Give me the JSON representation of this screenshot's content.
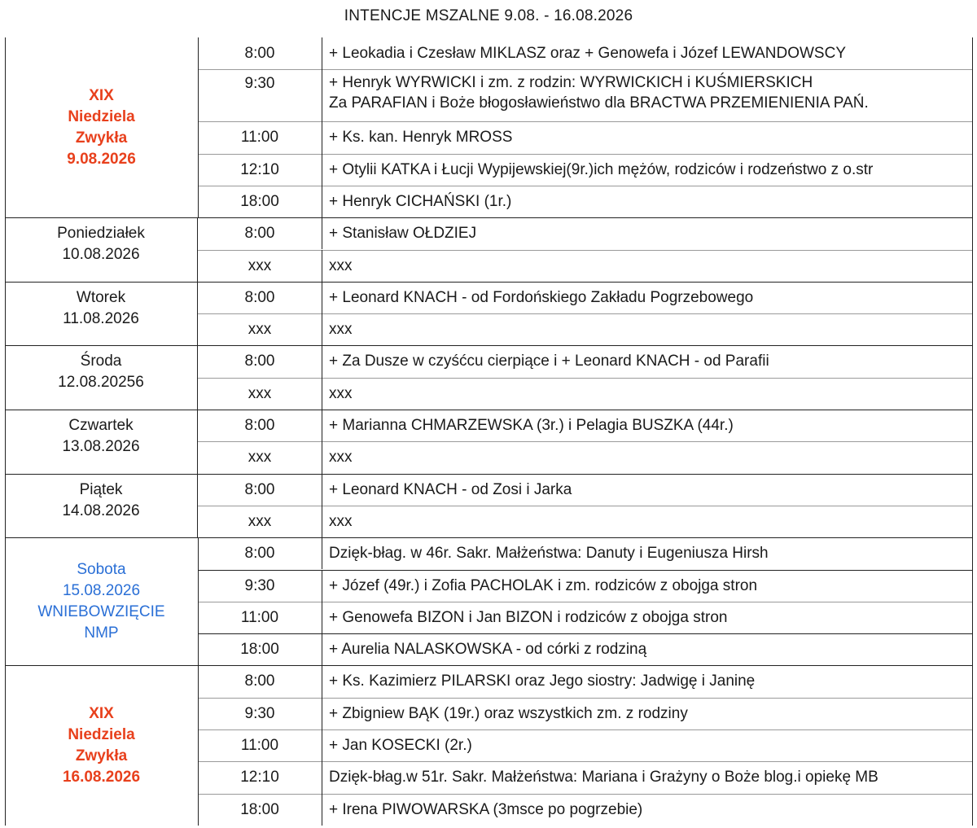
{
  "title": "INTENCJE MSZALNE 9.08. - 16.08.2026",
  "days": [
    {
      "label": [
        "XIX",
        "Niedziela",
        "Zwykła",
        "9.08.2026"
      ],
      "style": "red",
      "rows": [
        {
          "time": "8:00",
          "text": [
            "+ Leokadia i Czesław MIKLASZ oraz + Genowefa i Józef LEWANDOWSCY"
          ]
        },
        {
          "time": "9:30",
          "text": [
            "+ Henryk WYRWICKI i zm. z rodzin: WYRWICKICH i KUŚMIERSKICH",
            "Za PARAFIAN i  Boże błogosławieństwo dla BRACTWA PRZEMIENIENIA PAŃ."
          ]
        },
        {
          "time": "11:00",
          "text": [
            "+ Ks. kan. Henryk MROSS"
          ]
        },
        {
          "time": "12:10",
          "text": [
            "+ Otylii KATKA i Łucji Wypijewskiej(9r.)ich mężów, rodziców i rodzeństwo z o.str"
          ]
        },
        {
          "time": "18:00",
          "text": [
            "+ Henryk CICHAŃSKI (1r.)"
          ]
        }
      ]
    },
    {
      "label": [
        "Poniedziałek",
        "10.08.2026"
      ],
      "style": "plain",
      "rows": [
        {
          "time": "8:00",
          "text": [
            "+ Stanisław OŁDZIEJ"
          ]
        },
        {
          "time": "xxx",
          "text": [
            "xxx"
          ]
        }
      ]
    },
    {
      "label": [
        "Wtorek",
        "11.08.2026"
      ],
      "style": "plain",
      "rows": [
        {
          "time": "8:00",
          "text": [
            "+ Leonard KNACH - od Fordońskiego Zakładu Pogrzebowego"
          ]
        },
        {
          "time": "xxx",
          "text": [
            "xxx"
          ]
        }
      ]
    },
    {
      "label": [
        "Środa",
        "12.08.20256"
      ],
      "style": "plain",
      "rows": [
        {
          "time": "8:00",
          "text": [
            "+ Za Dusze w czyśćcu cierpiące i + Leonard KNACH - od Parafii"
          ]
        },
        {
          "time": "xxx",
          "text": [
            "xxx"
          ]
        }
      ]
    },
    {
      "label": [
        "Czwartek",
        "13.08.2026"
      ],
      "style": "plain",
      "rows": [
        {
          "time": "8:00",
          "text": [
            "+ Marianna CHMARZEWSKA (3r.) i Pelagia BUSZKA (44r.)"
          ]
        },
        {
          "time": "xxx",
          "text": [
            "xxx"
          ]
        }
      ]
    },
    {
      "label": [
        "Piątek",
        "14.08.2026"
      ],
      "style": "plain",
      "rows": [
        {
          "time": "8:00",
          "text": [
            "+ Leonard KNACH - od Zosi i Jarka"
          ]
        },
        {
          "time": "xxx",
          "text": [
            "xxx"
          ]
        }
      ]
    },
    {
      "label": [
        "Sobota",
        "15.08.2026",
        "WNIEBOWZIĘCIE",
        "NMP"
      ],
      "style": "blue",
      "rows": [
        {
          "time": "8:00",
          "text": [
            "Dzięk-błag. w 46r. Sakr. Małżeństwa: Danuty i Eugeniusza Hirsh"
          ]
        },
        {
          "time": "9:30",
          "text": [
            "+ Józef (49r.) i Zofia PACHOLAK i zm. rodziców z obojga stron"
          ]
        },
        {
          "time": "11:00",
          "text": [
            "+ Genowefa BIZON i Jan BIZON i rodziców  z obojga stron"
          ]
        },
        {
          "time": "18:00",
          "text": [
            "+ Aurelia NALASKOWSKA - od córki z rodziną"
          ]
        }
      ]
    },
    {
      "label": [
        "XIX",
        "Niedziela",
        "Zwykła",
        "16.08.2026"
      ],
      "style": "red",
      "rows": [
        {
          "time": "8:00",
          "text": [
            "+ Ks. Kazimierz PILARSKI oraz Jego siostry: Jadwigę i Janinę"
          ]
        },
        {
          "time": "9:30",
          "text": [
            "+ Zbigniew BĄK (19r.) oraz wszystkich zm. z rodziny"
          ]
        },
        {
          "time": "11:00",
          "text": [
            "+ Jan KOSECKI (2r.)"
          ]
        },
        {
          "time": "12:10",
          "text": [
            "Dzięk-błag.w 51r. Sakr. Małżeństwa: Mariana i Grażyny o Boże blog.i opiekę MB"
          ]
        },
        {
          "time": "18:00",
          "text": [
            "+ Irena PIWOWARSKA (3msce po pogrzebie)"
          ]
        }
      ]
    }
  ]
}
